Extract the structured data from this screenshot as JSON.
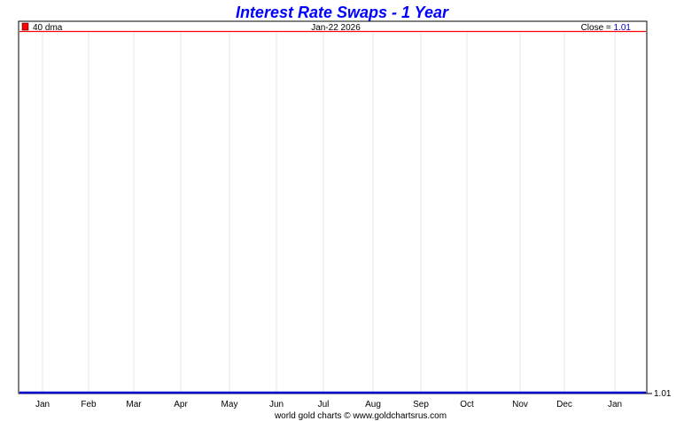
{
  "chart_data": {
    "type": "line",
    "title": "Interest Rate Swaps - 1 Year",
    "legend": {
      "label": "40 dma",
      "color": "#ff0000"
    },
    "date_label": "Jan-22  2026",
    "close_label": "Close = ",
    "close_value": "1.01",
    "x_ticks": [
      "Jan",
      "Feb",
      "Mar",
      "Apr",
      "May",
      "Jun",
      "Jul",
      "Aug",
      "Sep",
      "Oct",
      "Nov",
      "Dec",
      "Jan"
    ],
    "y_tick": "1.01",
    "series": [
      {
        "name": "Close",
        "color": "#0000cc",
        "values": [
          1.01,
          1.01
        ]
      },
      {
        "name": "40 dma",
        "color": "#ff0000",
        "values": [
          1.01,
          1.01
        ]
      }
    ],
    "footer": "world gold charts © www.goldchartsrus.com",
    "grid": true
  }
}
